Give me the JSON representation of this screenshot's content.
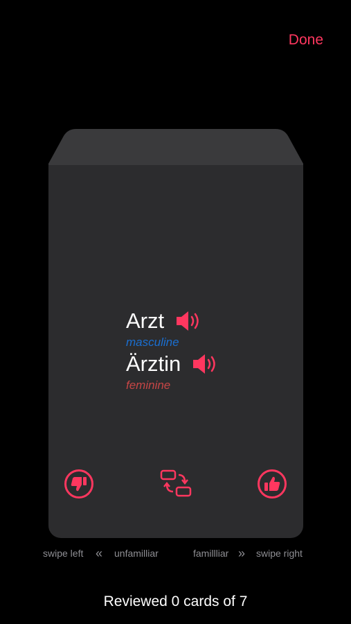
{
  "header": {
    "done_label": "Done"
  },
  "card": {
    "term1": {
      "word": "Arzt",
      "gender": "masculine"
    },
    "term2": {
      "word": "Ärztin",
      "gender": "feminine"
    }
  },
  "actions": {
    "unfamiliar_icon": "thumbs-down-icon",
    "flip_icon": "swap-cards-icon",
    "familiar_icon": "thumbs-up-icon"
  },
  "hints": {
    "swipe_left": "swipe left",
    "unfamiliar": "unfamilliar",
    "familiar": "famillliar",
    "swipe_right": "swipe right"
  },
  "footer": {
    "progress": "Reviewed 0 cards of 7"
  },
  "colors": {
    "accent": "#ff375f",
    "card": "#2c2c2e",
    "card_back": "#3a3a3c",
    "masculine": "#1a6fd1",
    "feminine": "#c74646"
  }
}
